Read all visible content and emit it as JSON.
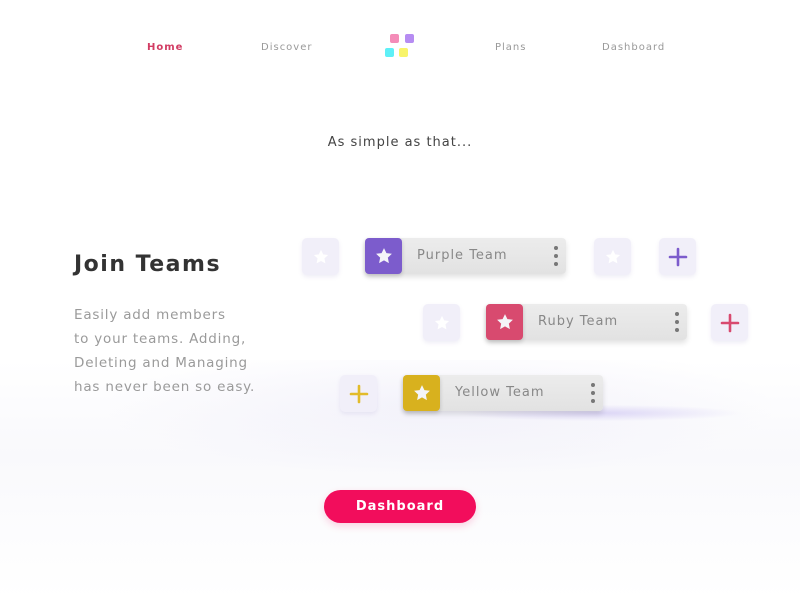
{
  "nav": {
    "items": [
      {
        "label": "Home",
        "active": true
      },
      {
        "label": "Discover",
        "active": false
      },
      {
        "label": "Plans",
        "active": false
      },
      {
        "label": "Dashboard",
        "active": false
      }
    ],
    "logo": {
      "icon": "four-squares-logo",
      "colors": [
        "#f48cb8",
        "#b68cf2",
        "#5ef0f7",
        "#f8f46a"
      ]
    }
  },
  "tagline": "As simple as that...",
  "feature": {
    "title": "Join Teams",
    "description_lines": [
      "Easily add members",
      "to your teams. Adding,",
      "Deleting and Managing",
      "has never been so easy."
    ]
  },
  "teams": [
    {
      "name": "Purple Team",
      "color": "#7c5ccc",
      "icon": "star-icon",
      "menu_icon": "kebab-menu-icon"
    },
    {
      "name": "Ruby Team",
      "color": "#d84a6f",
      "icon": "star-icon",
      "menu_icon": "kebab-menu-icon"
    },
    {
      "name": "Yellow Team",
      "color": "#d8b11e",
      "icon": "star-icon",
      "menu_icon": "kebab-menu-icon"
    }
  ],
  "accents": {
    "purple_plus": "#7c5ccc",
    "ruby_plus": "#d84a6f",
    "yellow_plus": "#e2bb2a",
    "cta": "#f20d5c",
    "home_active": "#d23c63"
  },
  "cta": {
    "label": "Dashboard"
  }
}
